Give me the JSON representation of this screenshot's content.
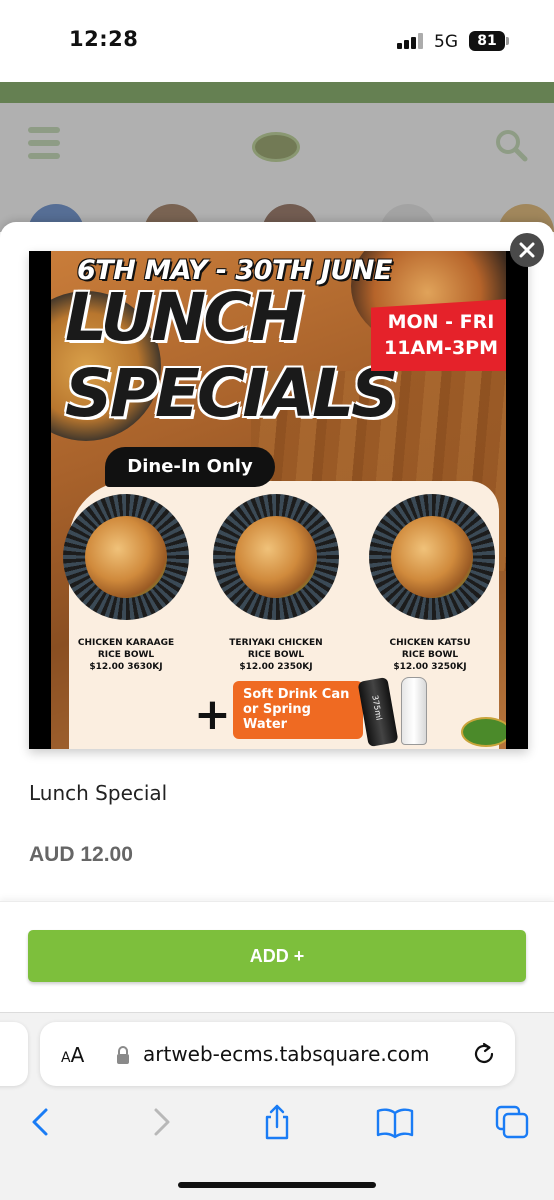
{
  "status_bar": {
    "time": "12:28",
    "network": "5G",
    "battery": "81"
  },
  "modal": {
    "close_icon": "close-icon",
    "promo_image": {
      "dates": "6TH MAY - 30TH JUNE",
      "headline_1": "LUNCH",
      "headline_2": "SPECIALS",
      "days": "MON - FRI",
      "hours": "11AM-3PM",
      "dine_in": "Dine-In Only",
      "dishes": [
        {
          "name_1": "CHICKEN KARAAGE",
          "name_2": "RICE BOWL",
          "detail": "$12.00 3630KJ"
        },
        {
          "name_1": "TERIYAKI CHICKEN",
          "name_2": "RICE BOWL",
          "detail": "$12.00 2350KJ"
        },
        {
          "name_1": "CHICKEN KATSU",
          "name_2": "RICE BOWL",
          "detail": "$12.00 3250KJ"
        }
      ],
      "plus": "+",
      "drink_offer": "Soft Drink Can or Spring Water",
      "can_label": "375ml"
    },
    "item_name": "Lunch Special",
    "item_price": "AUD 12.00",
    "add_button_label": "ADD +"
  },
  "browser": {
    "text_size_label_small": "A",
    "text_size_label_large": "A",
    "url": "artweb-ecms.tabsquare.com",
    "toolbar_icons": [
      "back-icon",
      "forward-icon",
      "share-icon",
      "bookmarks-icon",
      "tabs-icon"
    ]
  },
  "colors": {
    "brand_green": "#7dbf3c",
    "banner_green": "#4f8a25",
    "close_button": "#4a4a4a",
    "promo_red": "#e5222a",
    "promo_orange": "#ef6a22",
    "ios_blue": "#1a7cf5"
  }
}
